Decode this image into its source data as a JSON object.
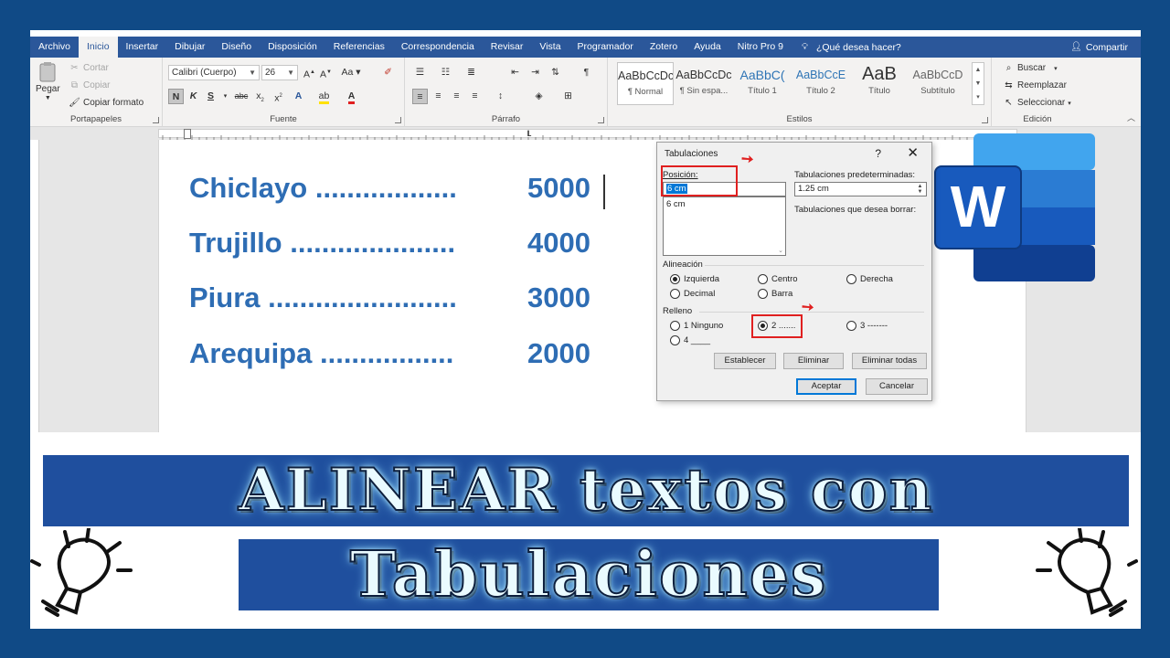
{
  "ribbon": {
    "tabs": [
      "Archivo",
      "Inicio",
      "Insertar",
      "Dibujar",
      "Diseño",
      "Disposición",
      "Referencias",
      "Correspondencia",
      "Revisar",
      "Vista",
      "Programador",
      "Zotero",
      "Ayuda",
      "Nitro Pro 9"
    ],
    "active_tab": "Inicio",
    "help_text": "¿Qué desea hacer?",
    "share_label": "Compartir",
    "clipboard": {
      "paste": "Pegar",
      "cut": "Cortar",
      "copy": "Copiar",
      "format_painter": "Copiar formato",
      "group": "Portapapeles"
    },
    "font": {
      "family": "Calibri (Cuerpo)",
      "size": "26",
      "group": "Fuente"
    },
    "paragraph": {
      "group": "Párrafo"
    },
    "styles": {
      "group": "Estilos",
      "items": [
        {
          "preview": "AaBbCcDc",
          "name": "¶ Normal"
        },
        {
          "preview": "AaBbCcDc",
          "name": "¶ Sin espa..."
        },
        {
          "preview": "AaBbC(",
          "name": "Título 1"
        },
        {
          "preview": "AaBbCcE",
          "name": "Título 2"
        },
        {
          "preview": "AaB",
          "name": "Título"
        },
        {
          "preview": "AaBbCcD",
          "name": "Subtítulo"
        }
      ]
    },
    "editing": {
      "find": "Buscar",
      "replace": "Reemplazar",
      "select": "Seleccionar",
      "group": "Edición"
    }
  },
  "document": {
    "lines": [
      {
        "city": "Chiclayo",
        "dots": "..................",
        "value": "5000"
      },
      {
        "city": "Trujillo",
        "dots": ".....................",
        "value": "4000"
      },
      {
        "city": "Piura",
        "dots": "........................",
        "value": "3000"
      },
      {
        "city": "Arequipa",
        "dots": ".................",
        "value": "2000"
      }
    ]
  },
  "dialog": {
    "title": "Tabulaciones",
    "help": "?",
    "close": "✕",
    "position_label": "Posición:",
    "position_value": "6 cm",
    "position_list": [
      "6 cm"
    ],
    "default_tabs_label": "Tabulaciones predeterminadas:",
    "default_tabs_value": "1.25 cm",
    "tabs_to_clear_label": "Tabulaciones que desea borrar:",
    "alignment_label": "Alineación",
    "alignment": {
      "left": "Izquierda",
      "center": "Centro",
      "right": "Derecha",
      "decimal": "Decimal",
      "bar": "Barra",
      "selected": "Izquierda"
    },
    "leader_label": "Relleno",
    "leader": {
      "opt1": "1 Ninguno",
      "opt2": "2 .......",
      "opt3": "3 -------",
      "opt4": "4 ____",
      "selected": "2 ......."
    },
    "buttons": {
      "set": "Establecer",
      "clear": "Eliminar",
      "clear_all": "Eliminar todas",
      "ok": "Aceptar",
      "cancel": "Cancelar"
    }
  },
  "logo": {
    "letter": "W",
    "colors": [
      "#41a5ee",
      "#2b7cd3",
      "#185abd",
      "#103f91"
    ]
  },
  "banner": {
    "line1": "ALINEAR textos con",
    "line2": "Tabulaciones"
  },
  "colors": {
    "accent": "#2b579a",
    "doc_text": "#2e6db4",
    "highlight": "#e02020",
    "frame": "#104a86"
  }
}
